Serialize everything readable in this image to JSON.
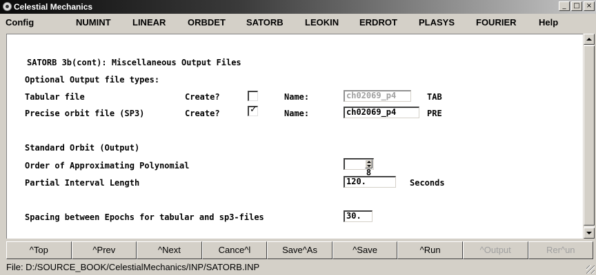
{
  "window": {
    "title": "Celestial Mechanics",
    "min_glyph": "_",
    "max_glyph": "□",
    "close_glyph": "×"
  },
  "menubar": [
    {
      "label": "Config"
    },
    {
      "label": "NUMINT"
    },
    {
      "label": "LINEAR"
    },
    {
      "label": "ORBDET"
    },
    {
      "label": "SATORB"
    },
    {
      "label": "LEOKIN"
    },
    {
      "label": "ERDROT"
    },
    {
      "label": "PLASYS"
    },
    {
      "label": "FOURIER"
    },
    {
      "label": "Help"
    }
  ],
  "form": {
    "heading": "SATORB 3b(cont): Miscellaneous Output Files",
    "optional_label": "Optional Output file types:",
    "tabular": {
      "label": "Tabular file",
      "create_label": "Create?",
      "create_checked": false,
      "name_label": "Name:",
      "name_value": "ch02069_p4",
      "ext": "TAB"
    },
    "precise": {
      "label": "Precise orbit file (SP3)",
      "create_label": "Create?",
      "create_checked": true,
      "check_glyph": "✓",
      "name_label": "Name:",
      "name_value": "ch02069_p4",
      "ext": "PRE"
    },
    "standard_orbit_label": "Standard Orbit (Output)",
    "order": {
      "label": "Order of Approximating Polynomial",
      "value": "8"
    },
    "interval": {
      "label": "Partial Interval Length",
      "value": "120.",
      "unit": "Seconds"
    },
    "spacing": {
      "label": "Spacing between Epochs for tabular and sp3-files",
      "value": "30."
    }
  },
  "toolbar": [
    {
      "label": "^Top",
      "enabled": true
    },
    {
      "label": "^Prev",
      "enabled": true
    },
    {
      "label": "^Next",
      "enabled": true
    },
    {
      "label": "Cance^l",
      "enabled": true
    },
    {
      "label": "Save^As",
      "enabled": true
    },
    {
      "label": "^Save",
      "enabled": true
    },
    {
      "label": "^Run",
      "enabled": true
    },
    {
      "label": "^Output",
      "enabled": false
    },
    {
      "label": "Rer^un",
      "enabled": false
    }
  ],
  "statusbar": {
    "text": "File: D:/SOURCE_BOOK/CelestialMechanics/INP/SATORB.INP"
  },
  "colors": {
    "chrome": "#d4d0c8",
    "panel": "#ffffff",
    "title_dark": "#0a0a0a",
    "disabled_text": "#a0a0a0"
  }
}
